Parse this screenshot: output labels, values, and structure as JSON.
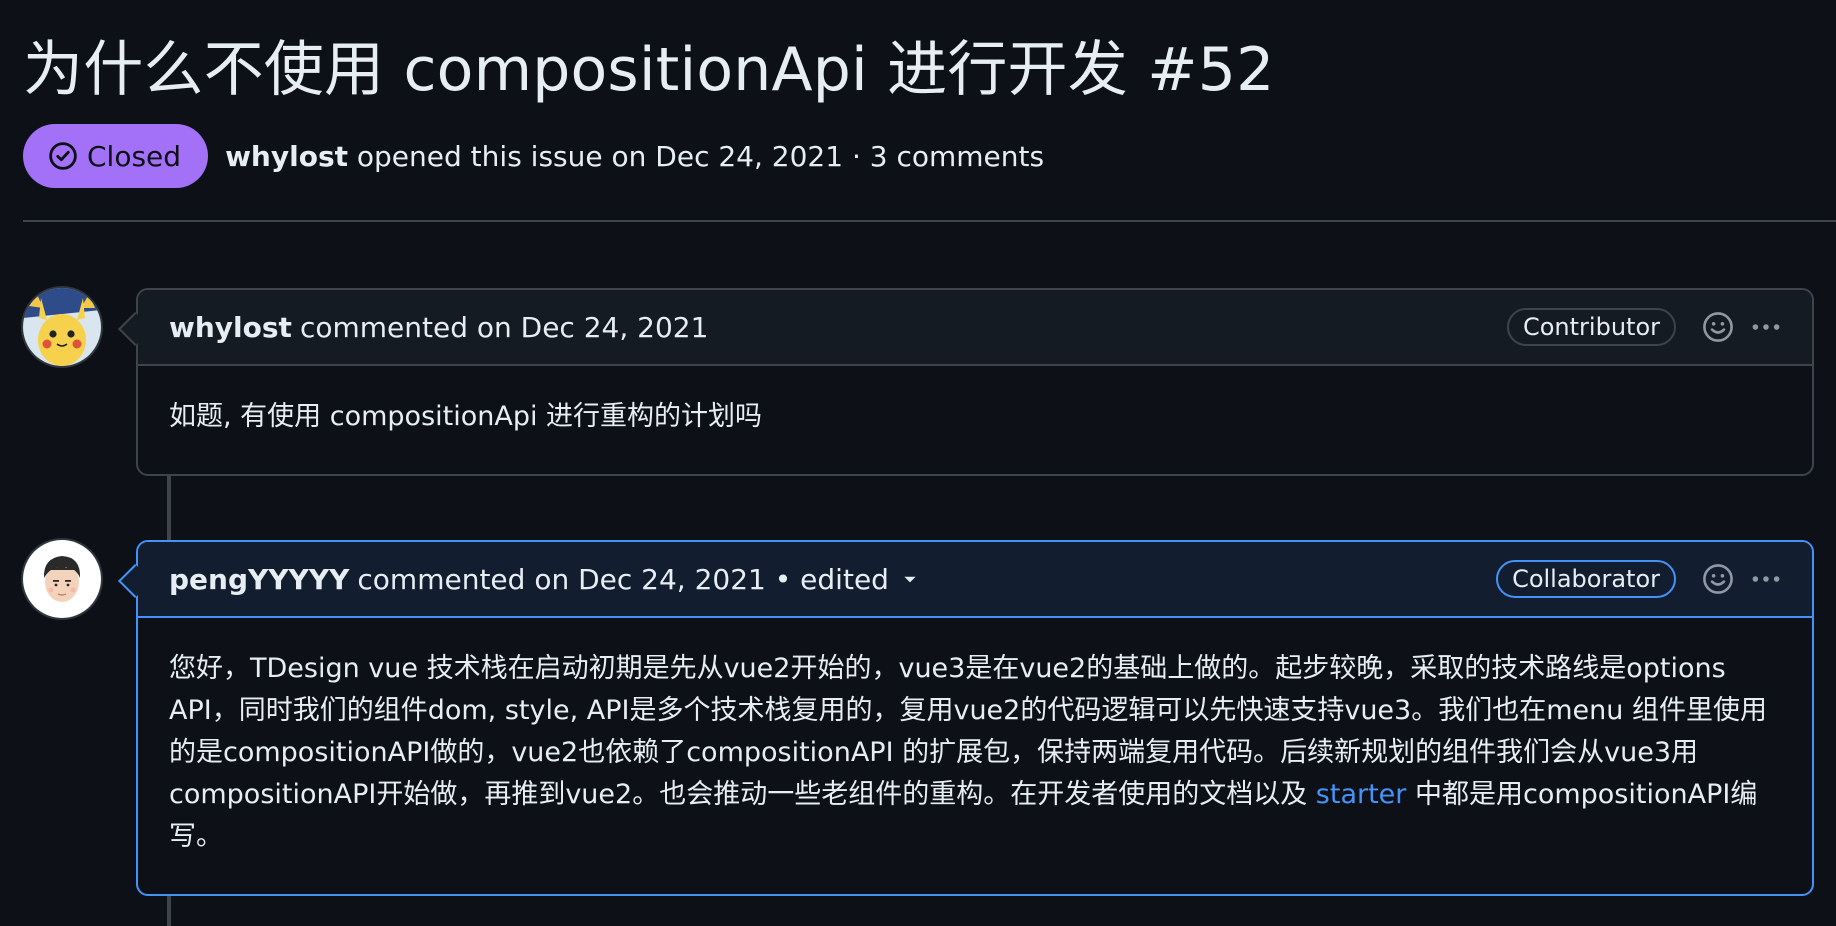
{
  "issue": {
    "title": "为什么不使用 compositionApi 进行开发",
    "number": "#52",
    "state": "Closed",
    "author": "whylost",
    "meta": "opened this issue on Dec 24, 2021 · 3 comments"
  },
  "comments": [
    {
      "author": "whylost",
      "header": "commented on Dec 24, 2021",
      "role": "Contributor",
      "body": "如题, 有使用 compositionApi 进行重构的计划吗"
    },
    {
      "author": "pengYYYYY",
      "header": "commented on Dec 24, 2021 • edited",
      "role": "Collaborator",
      "body_before_link": "您好，TDesign vue 技术栈在启动初期是先从vue2开始的，vue3是在vue2的基础上做的。起步较晚，采取的技术路线是options API，同时我们的组件dom, style, API是多个技术栈复用的，复用vue2的代码逻辑可以先快速支持vue3。我们也在menu 组件里使用的是compositionAPI做的，vue2也依赖了compositionAPI 的扩展包，保持两端复用代码。后续新规划的组件我们会从vue3用compositionAPI开始做，再推到vue2。也会推动一些老组件的重构。在开发者使用的文档以及 ",
      "link_text": "starter",
      "body_after_link": " 中都是用compositionAPI编写。"
    }
  ],
  "icons": {
    "state": "check-circle-icon",
    "reaction": "smiley-icon",
    "menu": "kebab-horizontal-icon",
    "edited_dropdown": "triangle-down-icon"
  },
  "colors": {
    "background": "#0d1117",
    "closed_badge": "#a371f7",
    "link": "#4493f8",
    "border": "#3d444d"
  }
}
